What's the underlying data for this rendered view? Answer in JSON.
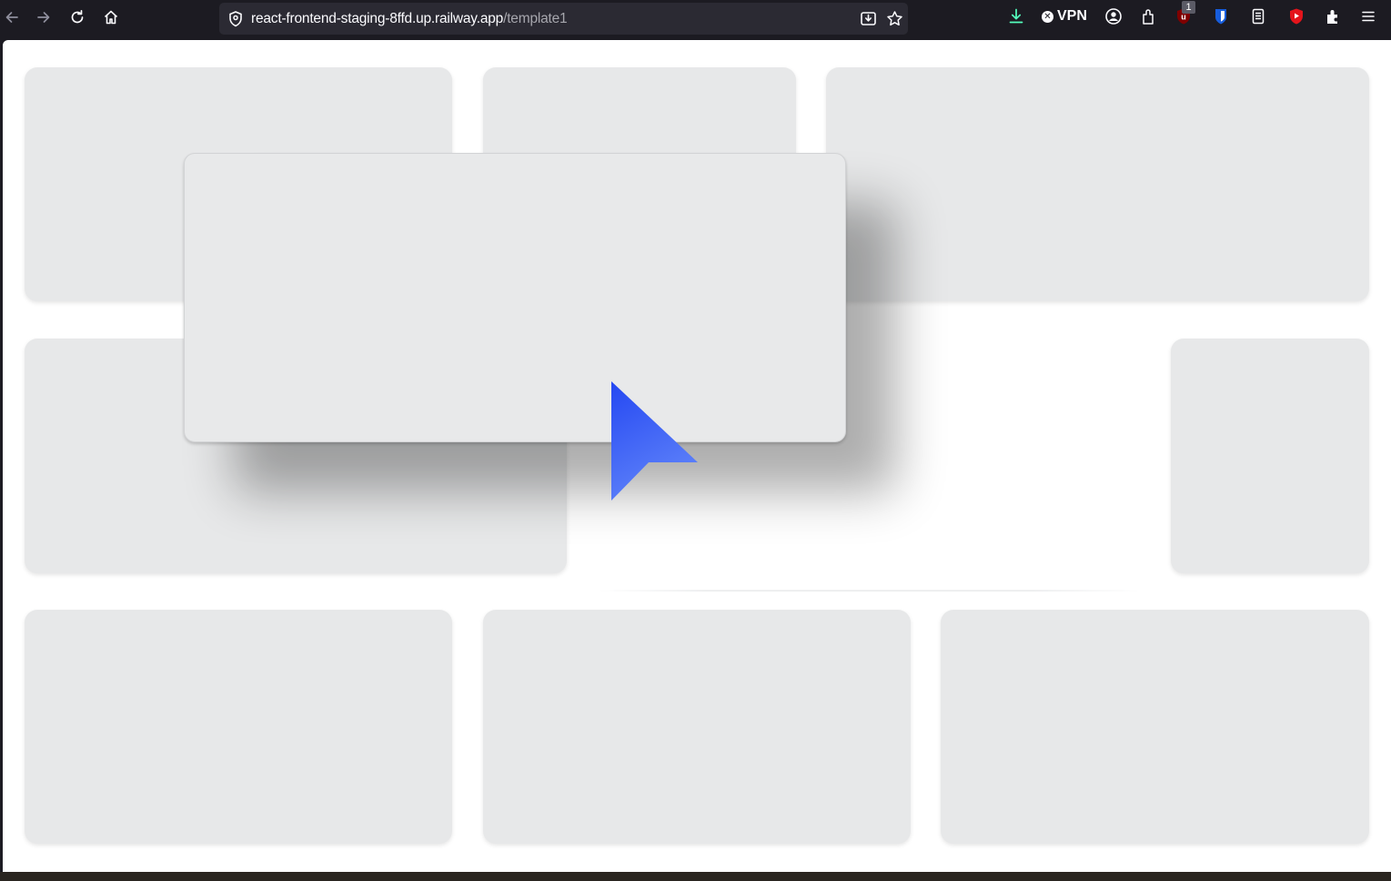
{
  "browser": {
    "url_host": "react-frontend-staging-8ffd.up.railway.app",
    "url_path": "/template1",
    "nav": {
      "back_icon": "arrow-left-icon",
      "forward_icon": "arrow-right-icon",
      "reload_icon": "reload-icon",
      "home_icon": "home-icon"
    },
    "url_actions": [
      "save-page-icon",
      "bookmark-star-icon"
    ],
    "extensions": {
      "vpn_label": "VPN",
      "ublock_badge": "1",
      "items": [
        "download-icon",
        "vpn-icon",
        "account-icon",
        "extension-puzzle-icon",
        "ublock-icon",
        "bitwarden-icon",
        "reader-icon",
        "youtube-icon",
        "extensions-icon",
        "menu-icon"
      ]
    }
  },
  "page": {
    "background": "#ffffff",
    "card_color": "#e7e8e9",
    "pointer_color": "#3a5cf5",
    "grid_cards": [
      {
        "id": "card-r1-c1"
      },
      {
        "id": "card-r1-c2"
      },
      {
        "id": "card-r1-c3"
      },
      {
        "id": "card-r2-c1"
      },
      {
        "id": "card-r2-c3"
      },
      {
        "id": "card-r3-c1"
      },
      {
        "id": "card-r3-c2"
      },
      {
        "id": "card-r3-c3"
      }
    ],
    "dragging_card": {
      "id": "dragged-card"
    }
  }
}
